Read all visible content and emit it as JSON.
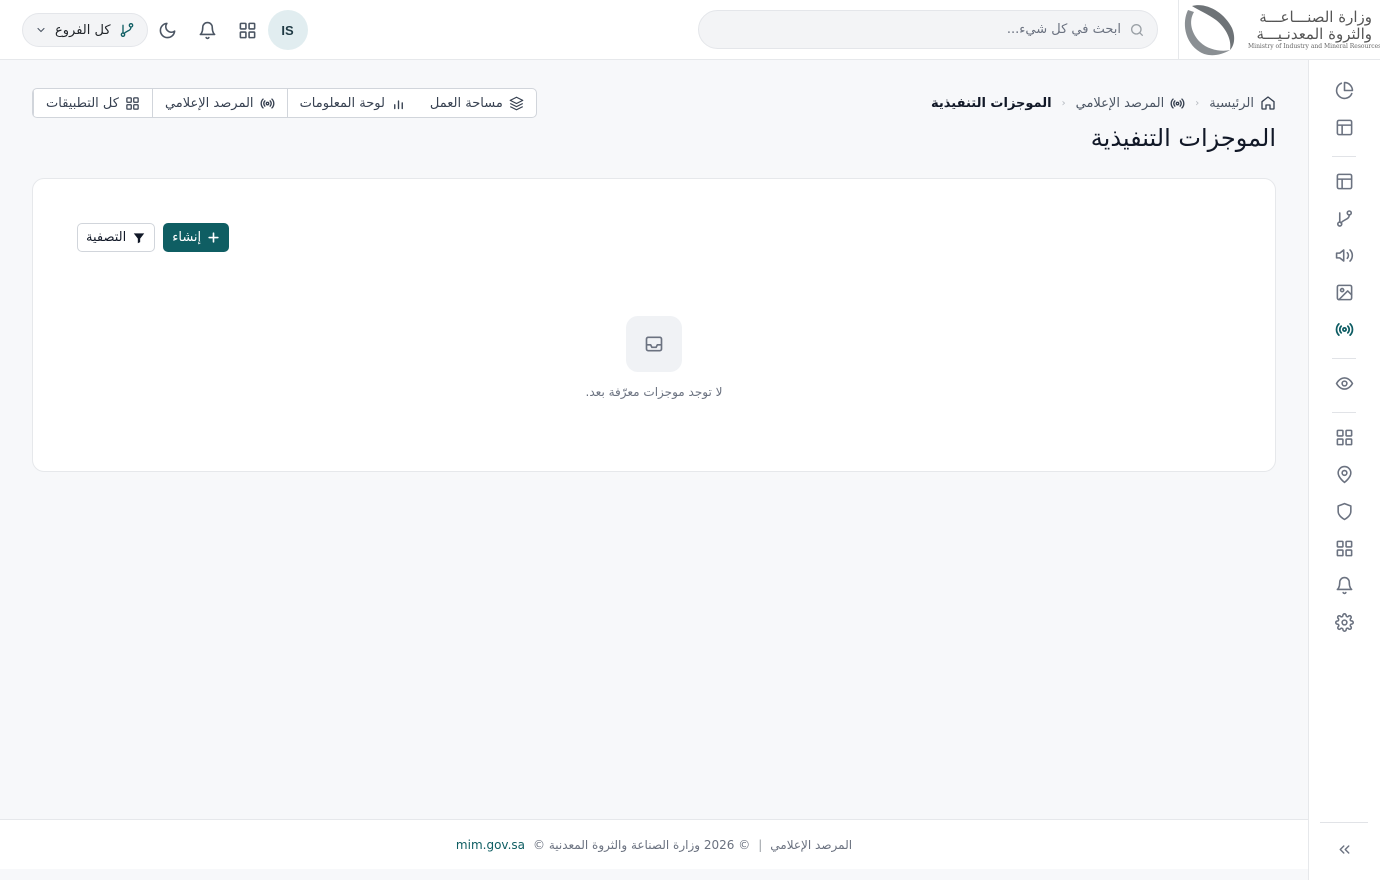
{
  "header": {
    "logo": {
      "line1": "وزارة الصنـــاعـــة",
      "line2": "والثروة المعدنـيـــة",
      "line3": "Ministry of Industry and Mineral Resources"
    },
    "search": {
      "placeholder": "ابحث في كل شيء..."
    },
    "branch_selector": {
      "label": "كل الفروع"
    },
    "user": {
      "initials": "IS"
    }
  },
  "sidebar": {
    "items": [
      {
        "icon": "pie-chart-icon"
      },
      {
        "icon": "layout-icon"
      },
      {
        "icon": "layout-icon"
      },
      {
        "icon": "git-branch-icon"
      },
      {
        "icon": "megaphone-icon"
      },
      {
        "icon": "image-icon"
      },
      {
        "icon": "radio-broadcast-icon",
        "active": true
      },
      {
        "icon": "eye-icon"
      },
      {
        "icon": "grid-icon"
      },
      {
        "icon": "map-pin-icon"
      },
      {
        "icon": "shield-icon"
      },
      {
        "icon": "grid-icon"
      },
      {
        "icon": "bell-icon"
      },
      {
        "icon": "gear-icon"
      }
    ],
    "collapse_icon": "chevrons-left-icon"
  },
  "breadcrumb": {
    "home": "الرئيسية",
    "parent": "المرصد الإعلامي",
    "current": "الموجزات التنفيذية"
  },
  "page": {
    "title": "الموجزات التنفيذية"
  },
  "toolbar": {
    "all_apps": "كل التطبيقات",
    "media_monitor": "المرصد الإعلامي",
    "dashboard": "لوحة المعلومات",
    "workspace": "مساحة العمل"
  },
  "card": {
    "filter_label": "التصفية",
    "create_label": "إنشاء",
    "empty_message": "لا توجد موجزات معرّفة بعد."
  },
  "footer": {
    "app_name": "المرصد الإعلامي",
    "separator": "|",
    "copyright": "© 2026 وزارة الصناعة والثروة المعدنية ©",
    "link": "mim.gov.sa"
  },
  "colors": {
    "accent": "#0f5e63",
    "background": "#f7f8fa",
    "avatar_bg": "#e1edf0"
  }
}
